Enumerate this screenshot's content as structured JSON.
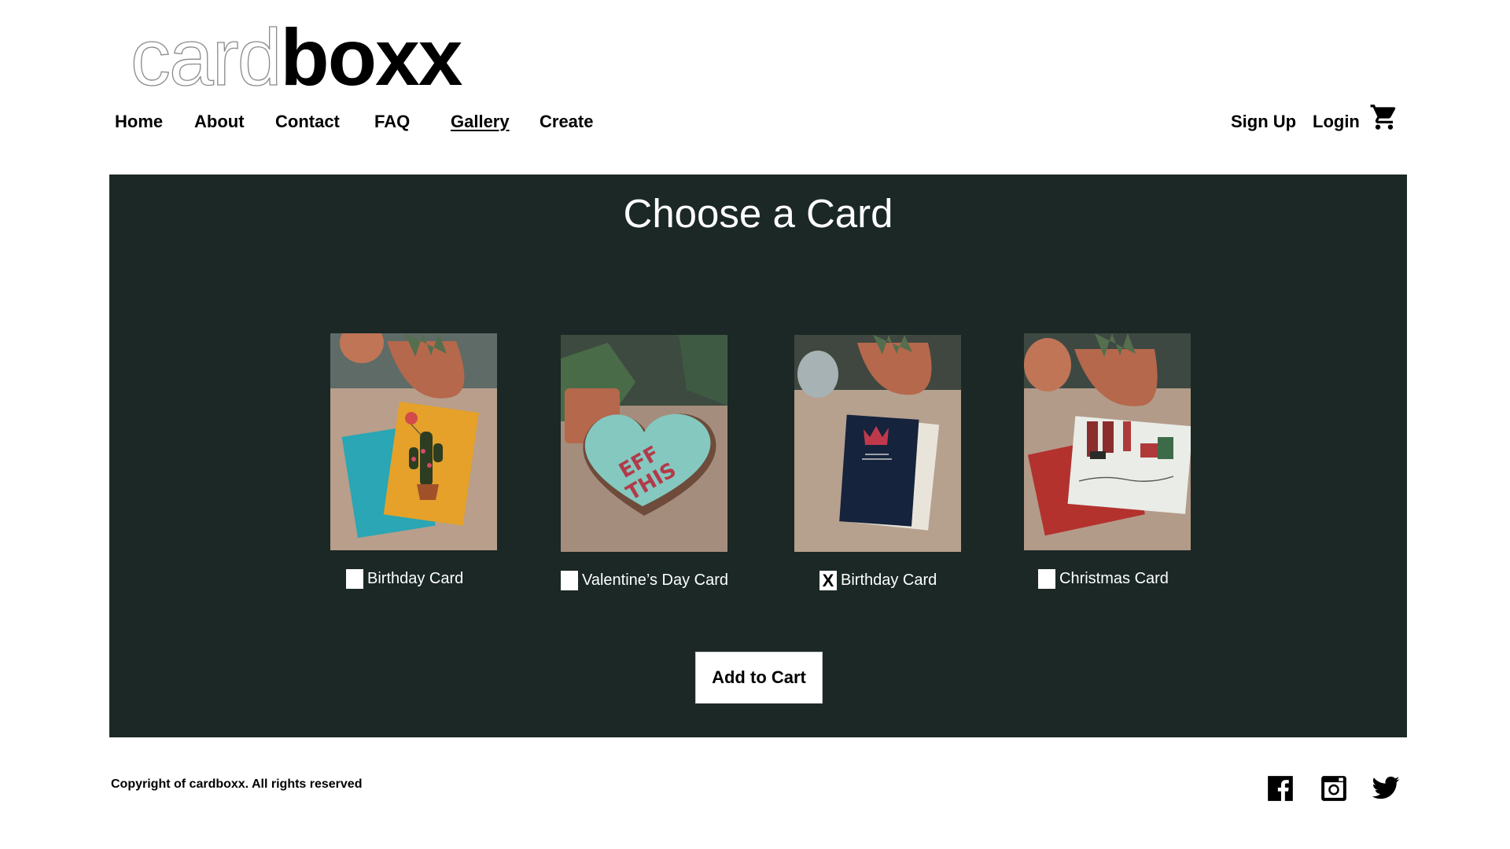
{
  "header": {
    "logo_light": "card",
    "logo_bold": "boxx",
    "nav": [
      {
        "label": "Home"
      },
      {
        "label": "About"
      },
      {
        "label": "Contact"
      },
      {
        "label": "FAQ"
      },
      {
        "label": "Gallery",
        "active": true
      },
      {
        "label": "Create"
      }
    ],
    "sign_up": "Sign Up",
    "login": "Login",
    "cart_icon": "shopping-cart-icon"
  },
  "main": {
    "title": "Choose a Card",
    "cards": [
      {
        "label": "Birthday Card",
        "checked": false,
        "image": "cactus-birthday-card-photo"
      },
      {
        "label": "Valentine’s Day Card",
        "checked": false,
        "image": "heart-candy-box-photo"
      },
      {
        "label": "Birthday Card",
        "checked": true,
        "check_mark": "X",
        "image": "navy-crown-card-photo"
      },
      {
        "label": "Christmas Card",
        "checked": false,
        "image": "christmas-stockings-card-photo"
      }
    ],
    "add_to_cart": "Add to Cart"
  },
  "footer": {
    "copyright": "Copyright of cardboxx. All rights reserved",
    "social": [
      "facebook-icon",
      "instagram-icon",
      "twitter-icon"
    ]
  },
  "colors": {
    "panel_bg": "#1b2826",
    "text": "#000000",
    "panel_text": "#ffffff"
  }
}
